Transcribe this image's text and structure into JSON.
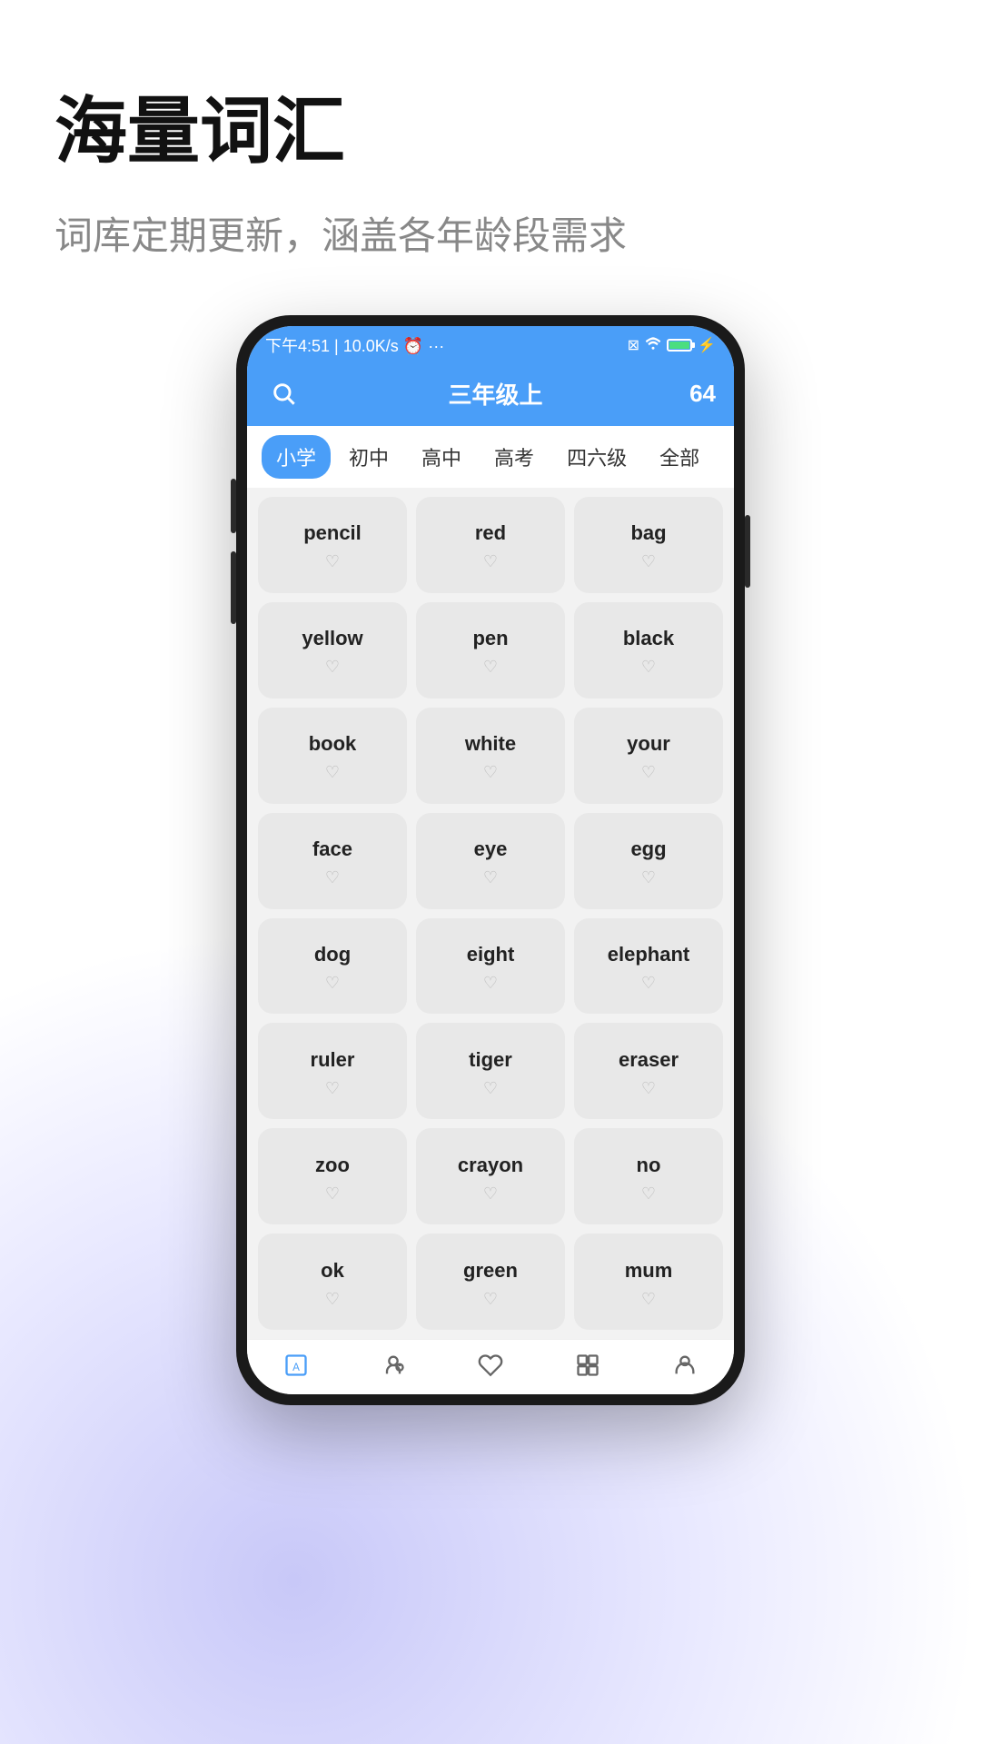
{
  "page": {
    "bg_gradient": true
  },
  "hero": {
    "title": "海量词汇",
    "subtitle": "词库定期更新，涵盖各年龄段需求"
  },
  "status_bar": {
    "time": "下午4:51",
    "speed": "10.0K/s",
    "alarm": "⏰",
    "dots": "···",
    "battery_level": 100
  },
  "app_header": {
    "title": "三年级上",
    "word_count": "64"
  },
  "filter_tabs": [
    {
      "label": "小学",
      "active": true
    },
    {
      "label": "初中",
      "active": false
    },
    {
      "label": "高中",
      "active": false
    },
    {
      "label": "高考",
      "active": false
    },
    {
      "label": "四六级",
      "active": false
    },
    {
      "label": "全部",
      "active": false
    }
  ],
  "words": [
    {
      "text": "pencil"
    },
    {
      "text": "red"
    },
    {
      "text": "bag"
    },
    {
      "text": "yellow"
    },
    {
      "text": "pen"
    },
    {
      "text": "black"
    },
    {
      "text": "book"
    },
    {
      "text": "white"
    },
    {
      "text": "your"
    },
    {
      "text": "face"
    },
    {
      "text": "eye"
    },
    {
      "text": "egg"
    },
    {
      "text": "dog"
    },
    {
      "text": "eight"
    },
    {
      "text": "elephant"
    },
    {
      "text": "ruler"
    },
    {
      "text": "tiger"
    },
    {
      "text": "eraser"
    },
    {
      "text": "zoo"
    },
    {
      "text": "crayon"
    },
    {
      "text": "no"
    },
    {
      "text": "ok"
    },
    {
      "text": "green"
    },
    {
      "text": "mum"
    }
  ],
  "bottom_nav": [
    {
      "id": "vocab",
      "label": "词库",
      "active": true
    },
    {
      "id": "learn",
      "label": "学习",
      "active": false
    },
    {
      "id": "favorite",
      "label": "收藏",
      "active": false
    },
    {
      "id": "expand",
      "label": "拓展",
      "active": false
    },
    {
      "id": "profile",
      "label": "我的",
      "active": false
    }
  ]
}
